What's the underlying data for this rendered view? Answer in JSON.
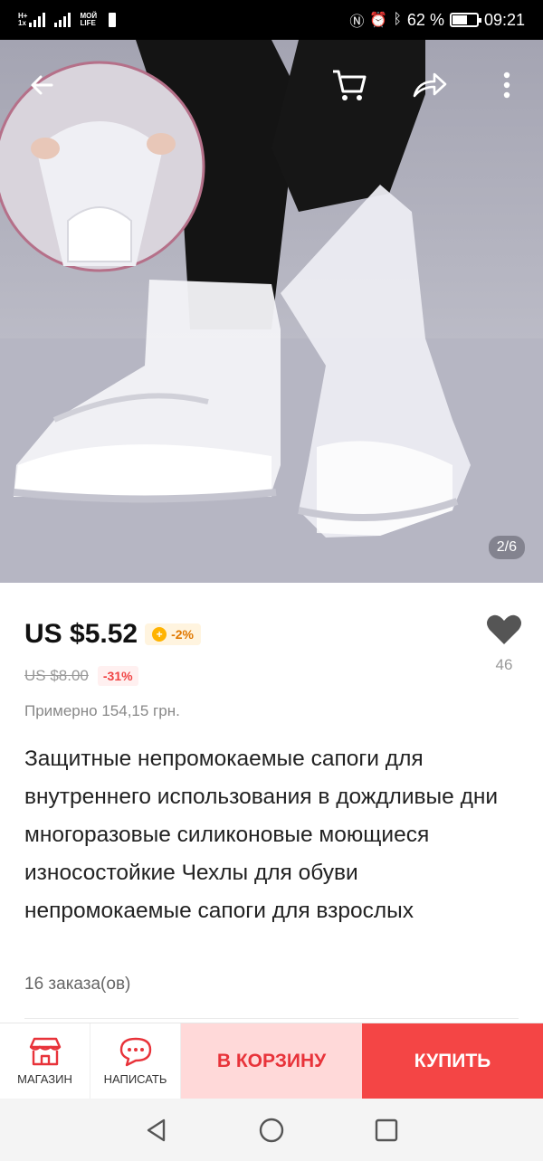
{
  "status_bar": {
    "network_1": "H+",
    "network_1_sub": "1x",
    "carrier_2": "МОЙ LIFE",
    "icons": [
      "nfc-icon",
      "alarm-icon",
      "bluetooth-icon"
    ],
    "battery": "62 %",
    "battery_level": 0.62,
    "time": "09:21"
  },
  "hero": {
    "icons": [
      "back-arrow-icon",
      "cart-icon",
      "share-icon",
      "more-vert-icon"
    ],
    "counter": "2/6"
  },
  "product": {
    "price": "US $5.52",
    "coin_discount": "-2%",
    "old_price": "US $8.00",
    "discount": "-31%",
    "approx_price": "Примерно 154,15 грн.",
    "wishlist_count": "46",
    "title": "Защитные непромокаемые сапоги для внутреннего использования в дождливые дни многоразовые силиконовые моющиеся износостойкие Чехлы для обуви непромокаемые сапоги для взрослых",
    "orders": "16 заказа(ов)"
  },
  "bottom_bar": {
    "store_label": "МАГАЗИН",
    "message_label": "НАПИСАТЬ",
    "add_to_cart": "В КОРЗИНУ",
    "buy_now": "КУПИТЬ",
    "colors": {
      "cart_bg": "#ffd9d9",
      "buy_bg": "#f44545",
      "accent": "#e8333a"
    }
  },
  "nav_bar": {
    "icons": [
      "back-triangle-icon",
      "home-circle-icon",
      "recents-square-icon"
    ]
  }
}
